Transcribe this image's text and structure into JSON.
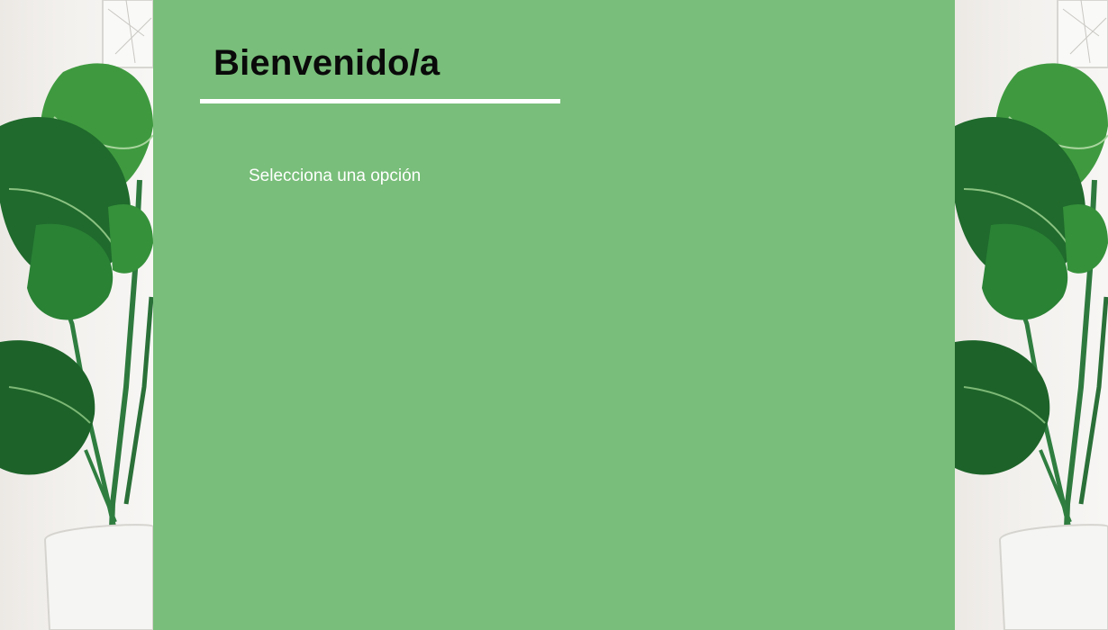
{
  "welcome": {
    "title": "Bienvenido/a",
    "prompt": "Selecciona una opción"
  },
  "colors": {
    "panel_background": "#79be7a",
    "title_text": "#0a0a0a",
    "underline": "#ffffff",
    "prompt_text": "#ffffff"
  },
  "icons": {
    "background_decoration": "monstera-plant-image"
  }
}
